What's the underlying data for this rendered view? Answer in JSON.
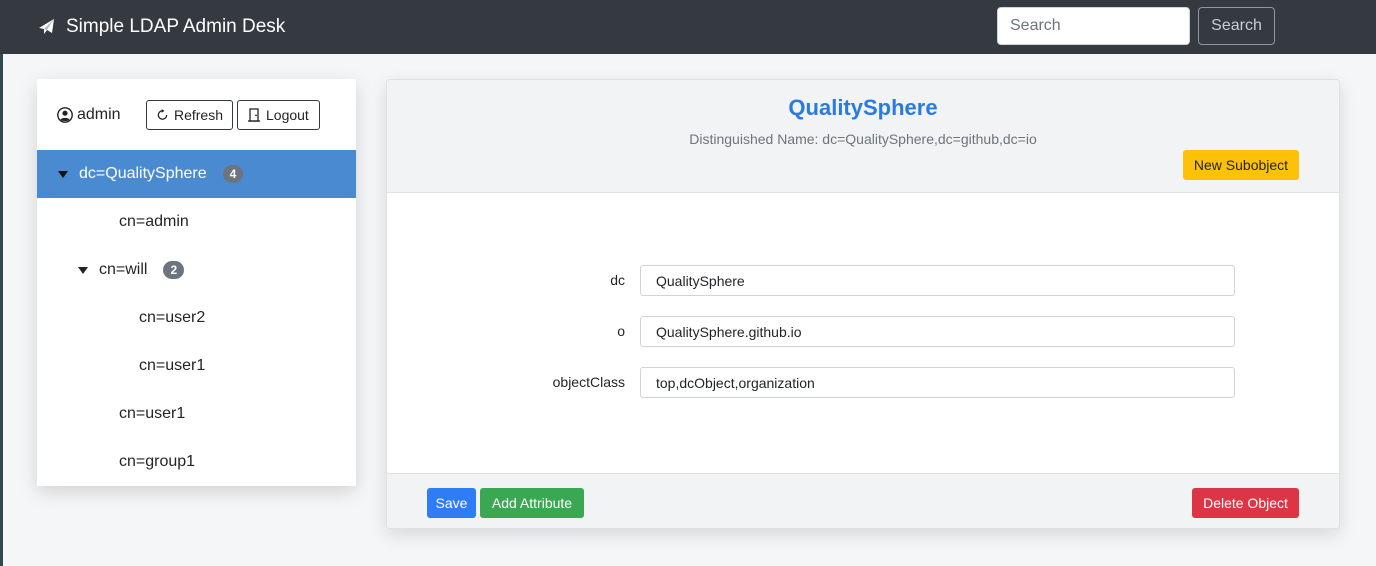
{
  "app": {
    "title": "Simple LDAP Admin Desk",
    "icon": "paper-plane-icon"
  },
  "search": {
    "placeholder": "Search",
    "button_label": "Search"
  },
  "sidebar": {
    "user": {
      "icon": "user-circle-icon",
      "name": "admin"
    },
    "refresh_label": "Refresh",
    "logout_label": "Logout",
    "tree": [
      {
        "label": "dc=QualitySphere",
        "count": "4",
        "expanded": true,
        "selected": true,
        "depth": 0
      },
      {
        "label": "cn=admin",
        "depth": 1
      },
      {
        "label": "cn=will",
        "count": "2",
        "expanded": true,
        "depth": 1
      },
      {
        "label": "cn=user2",
        "depth": 2
      },
      {
        "label": "cn=user1",
        "depth": 2
      },
      {
        "label": "cn=user1",
        "depth": 1
      },
      {
        "label": "cn=group1",
        "depth": 1
      }
    ]
  },
  "object": {
    "title": "QualitySphere",
    "dn": "Distinguished Name: dc=QualitySphere,dc=github,dc=io",
    "new_subobject_label": "New Subobject",
    "attributes": [
      {
        "name": "dc",
        "value": "QualitySphere"
      },
      {
        "name": "o",
        "value": "QualitySphere.github.io"
      },
      {
        "name": "objectClass",
        "value": "top,dcObject,organization"
      }
    ],
    "save_label": "Save",
    "add_attribute_label": "Add Attribute",
    "delete_label": "Delete Object"
  },
  "colors": {
    "navbar": "#343a40",
    "selected_row": "#4a8ad0",
    "title": "#2a7ae2",
    "warning": "#ffc107",
    "primary": "#2f7df6",
    "success": "#3aa852",
    "danger": "#dc3545"
  }
}
